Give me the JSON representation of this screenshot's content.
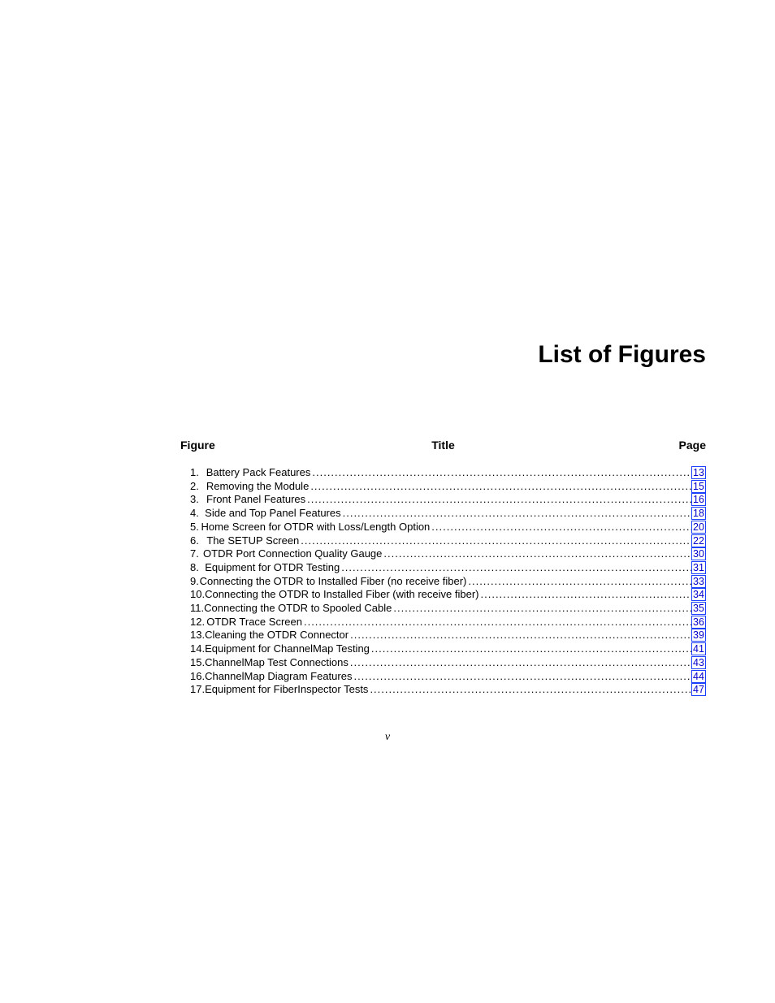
{
  "heading": "List of Figures",
  "columns": {
    "figure": "Figure",
    "title": "Title",
    "page": "Page"
  },
  "entries": [
    {
      "num": "1.",
      "title": "Battery Pack Features",
      "page": "13"
    },
    {
      "num": "2.",
      "title": "Removing the Module ",
      "page": "15"
    },
    {
      "num": "3.",
      "title": "Front Panel Features ",
      "page": "16"
    },
    {
      "num": "4.",
      "title": "Side and Top Panel Features ",
      "page": "18"
    },
    {
      "num": "5.",
      "title": "Home Screen for OTDR with Loss/Length Option ",
      "page": "20"
    },
    {
      "num": "6.",
      "title": "The SETUP Screen",
      "page": "22"
    },
    {
      "num": "7.",
      "title": "OTDR Port Connection Quality Gauge",
      "page": "30"
    },
    {
      "num": "8.",
      "title": "Equipment for OTDR Testing ",
      "page": "31"
    },
    {
      "num": "9.",
      "title": "Connecting the OTDR to Installed Fiber (no receive fiber)",
      "page": "33"
    },
    {
      "num": "10.",
      "title": "Connecting the OTDR to Installed Fiber (with receive fiber)",
      "page": "34"
    },
    {
      "num": "11.",
      "title": "Connecting the OTDR to Spooled Cable",
      "page": "35"
    },
    {
      "num": "12.",
      "title": "OTDR Trace Screen",
      "page": "36"
    },
    {
      "num": "13.",
      "title": "Cleaning the OTDR Connector ",
      "page": "39"
    },
    {
      "num": "14.",
      "title": "Equipment for ChannelMap Testing",
      "page": "41"
    },
    {
      "num": "15.",
      "title": "ChannelMap Test Connections",
      "page": "43"
    },
    {
      "num": "16.",
      "title": "ChannelMap Diagram Features",
      "page": "44"
    },
    {
      "num": "17.",
      "title": "Equipment for FiberInspector Tests ",
      "page": "47"
    }
  ],
  "footer_page": "v"
}
